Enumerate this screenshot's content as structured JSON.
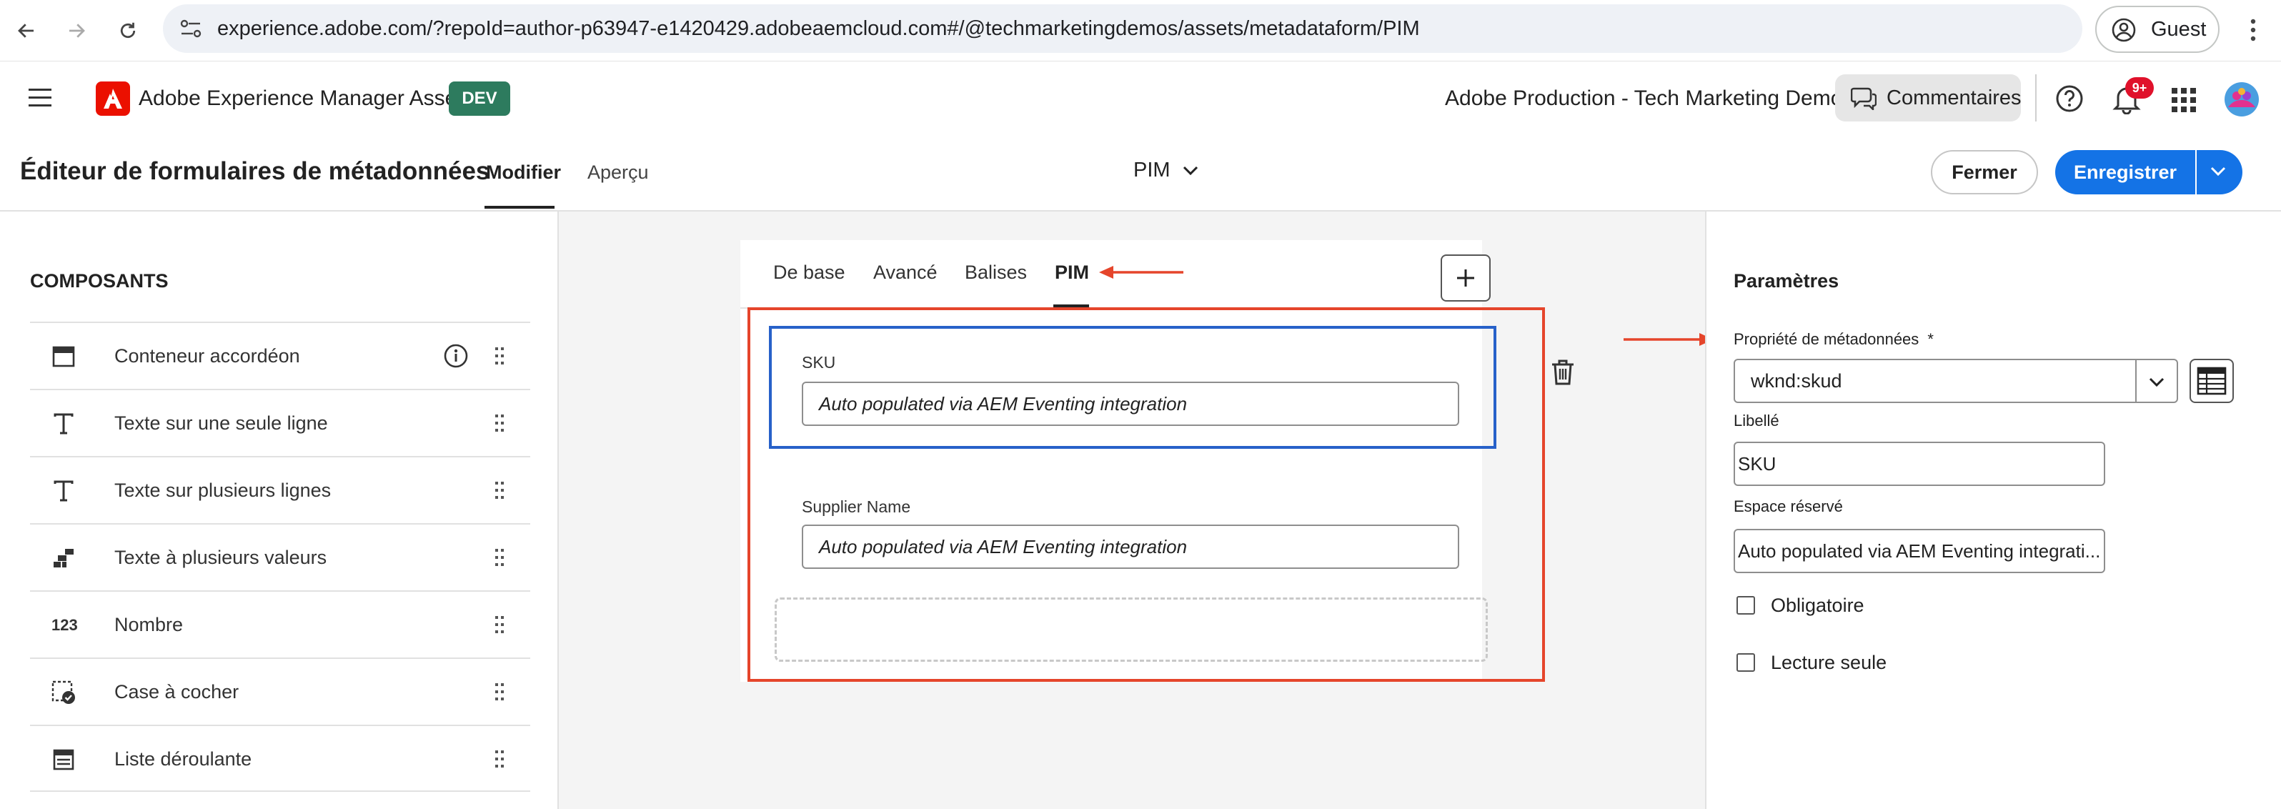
{
  "browser": {
    "url": "experience.adobe.com/?repoId=author-p63947-e1420429.adobeaemcloud.com#/@techmarketingdemos/assets/metadataform/PIM",
    "profile_label": "Guest"
  },
  "header": {
    "app_name": "Adobe Experience Manager Assets",
    "env_badge": "DEV",
    "org_name": "Adobe Production - Tech Marketing Demos",
    "comments_label": "Commentaires",
    "notifications_count": "9+"
  },
  "editor": {
    "title": "Éditeur de formulaires de métadonnées",
    "tabs": [
      {
        "label": "Modifier",
        "selected": true
      },
      {
        "label": "Aperçu",
        "selected": false
      }
    ],
    "form_name": "PIM",
    "close_label": "Fermer",
    "save_label": "Enregistrer"
  },
  "components": {
    "title": "COMPOSANTS",
    "items": [
      {
        "label": "Conteneur accordéon",
        "icon": "accordion-icon"
      },
      {
        "label": "Texte sur une seule ligne",
        "icon": "text-icon"
      },
      {
        "label": "Texte sur plusieurs lignes",
        "icon": "text-icon"
      },
      {
        "label": "Texte à plusieurs valeurs",
        "icon": "multi-value-icon"
      },
      {
        "label": "Nombre",
        "icon": "number-icon",
        "icon_text": "123"
      },
      {
        "label": "Case à cocher",
        "icon": "checkbox-icon"
      },
      {
        "label": "Liste déroulante",
        "icon": "dropdown-list-icon"
      }
    ]
  },
  "form": {
    "tabs": [
      {
        "label": "De base",
        "selected": false
      },
      {
        "label": "Avancé",
        "selected": false
      },
      {
        "label": "Balises",
        "selected": false
      },
      {
        "label": "PIM",
        "selected": true
      }
    ],
    "fields": [
      {
        "label": "SKU",
        "placeholder": "Auto populated via AEM Eventing integration",
        "selected": true
      },
      {
        "label": "Supplier Name",
        "placeholder": "Auto populated via AEM Eventing integration",
        "selected": false
      }
    ]
  },
  "settings": {
    "title": "Paramètres",
    "property_label": "Propriété de métadonnées",
    "property_required_mark": "*",
    "property_value": "wknd:skud",
    "label_label": "Libellé",
    "label_value": "SKU",
    "placeholder_label": "Espace réservé",
    "placeholder_value": "Auto populated via AEM Eventing integrati...",
    "checkboxes": [
      {
        "label": "Obligatoire",
        "checked": false
      },
      {
        "label": "Lecture seule",
        "checked": false
      }
    ]
  },
  "colors": {
    "accent_blue": "#1473e6",
    "env_badge_green": "#2d7b5e",
    "annotation_red": "#e5452b",
    "selection_blue": "#2761c9",
    "adobe_red": "#eb1000"
  }
}
